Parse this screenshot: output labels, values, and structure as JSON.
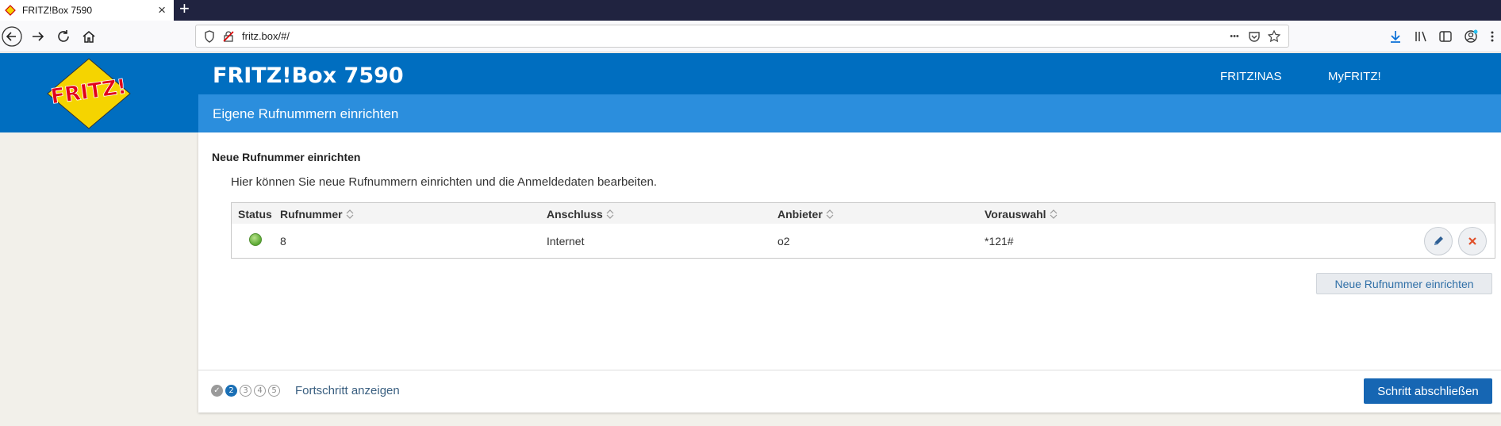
{
  "browser": {
    "tab_title": "FRITZ!Box 7590",
    "tab_close": "×",
    "new_tab": "+",
    "url": "fritz.box/#/",
    "url_more": "•••"
  },
  "header": {
    "logo_text": "FRITZ!",
    "title": "FRITZ!Box 7590",
    "links": [
      "FRITZ!NAS",
      "MyFRITZ!"
    ],
    "subtitle": "Eigene Rufnummern einrichten"
  },
  "content": {
    "section_title": "Neue Rufnummer einrichten",
    "description": "Hier können Sie neue Rufnummern einrichten und die Anmeldedaten bearbeiten.",
    "table": {
      "headers": {
        "status": "Status",
        "number": "Rufnummer",
        "connection": "Anschluss",
        "provider": "Anbieter",
        "preselect": "Vorauswahl"
      },
      "rows": [
        {
          "status": "active",
          "number": "8",
          "connection": "Internet",
          "provider": "o2",
          "preselect": "*121#"
        }
      ]
    },
    "add_button": "Neue Rufnummer einrichten"
  },
  "footer": {
    "steps": [
      "✓",
      "2",
      "3",
      "4",
      "5"
    ],
    "progress_link": "Fortschritt anzeigen",
    "finish_button": "Schritt abschließen"
  },
  "colors": {
    "header_blue": "#006ec0",
    "subbar_blue": "#2b8edd",
    "primary_button": "#1666b3",
    "status_green": "#5aa833"
  }
}
